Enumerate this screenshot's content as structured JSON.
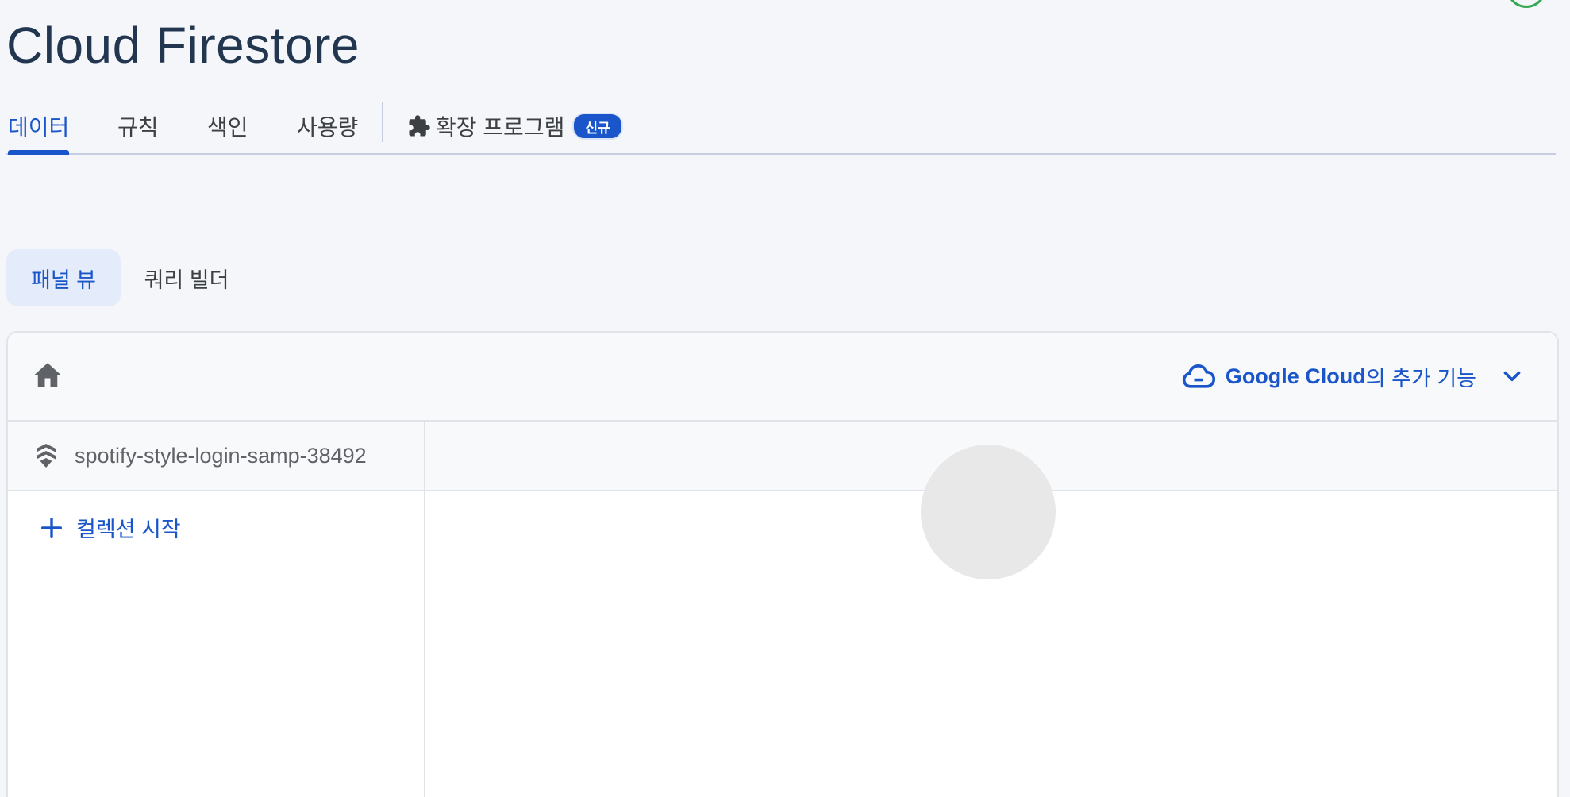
{
  "page": {
    "title": "Cloud Firestore"
  },
  "tabs": [
    {
      "label": "데이터",
      "active": true
    },
    {
      "label": "규칙",
      "active": false
    },
    {
      "label": "색인",
      "active": false
    },
    {
      "label": "사용량",
      "active": false
    },
    {
      "label": "확장 프로그램",
      "icon": "puzzle-icon",
      "badge": "신규",
      "active": false
    }
  ],
  "view_toggle": {
    "panel_view": "패널 뷰",
    "query_builder": "쿼리 빌더",
    "selected": "panel_view"
  },
  "toolbar": {
    "home_icon": "home-icon",
    "google_cloud_label": "Google Cloud",
    "google_cloud_suffix": "의 추가 기능",
    "cloud_icon": "cloud-icon",
    "chevron_icon": "chevron-down-icon"
  },
  "database": {
    "name": "spotify-style-login-samp-38492",
    "icon": "firestore-database-icon"
  },
  "actions": {
    "start_collection": "컬렉션 시작"
  },
  "colors": {
    "accent": "#1a56c9",
    "title": "#233650",
    "background": "#f5f6f9",
    "badge": "#1a56c9"
  }
}
